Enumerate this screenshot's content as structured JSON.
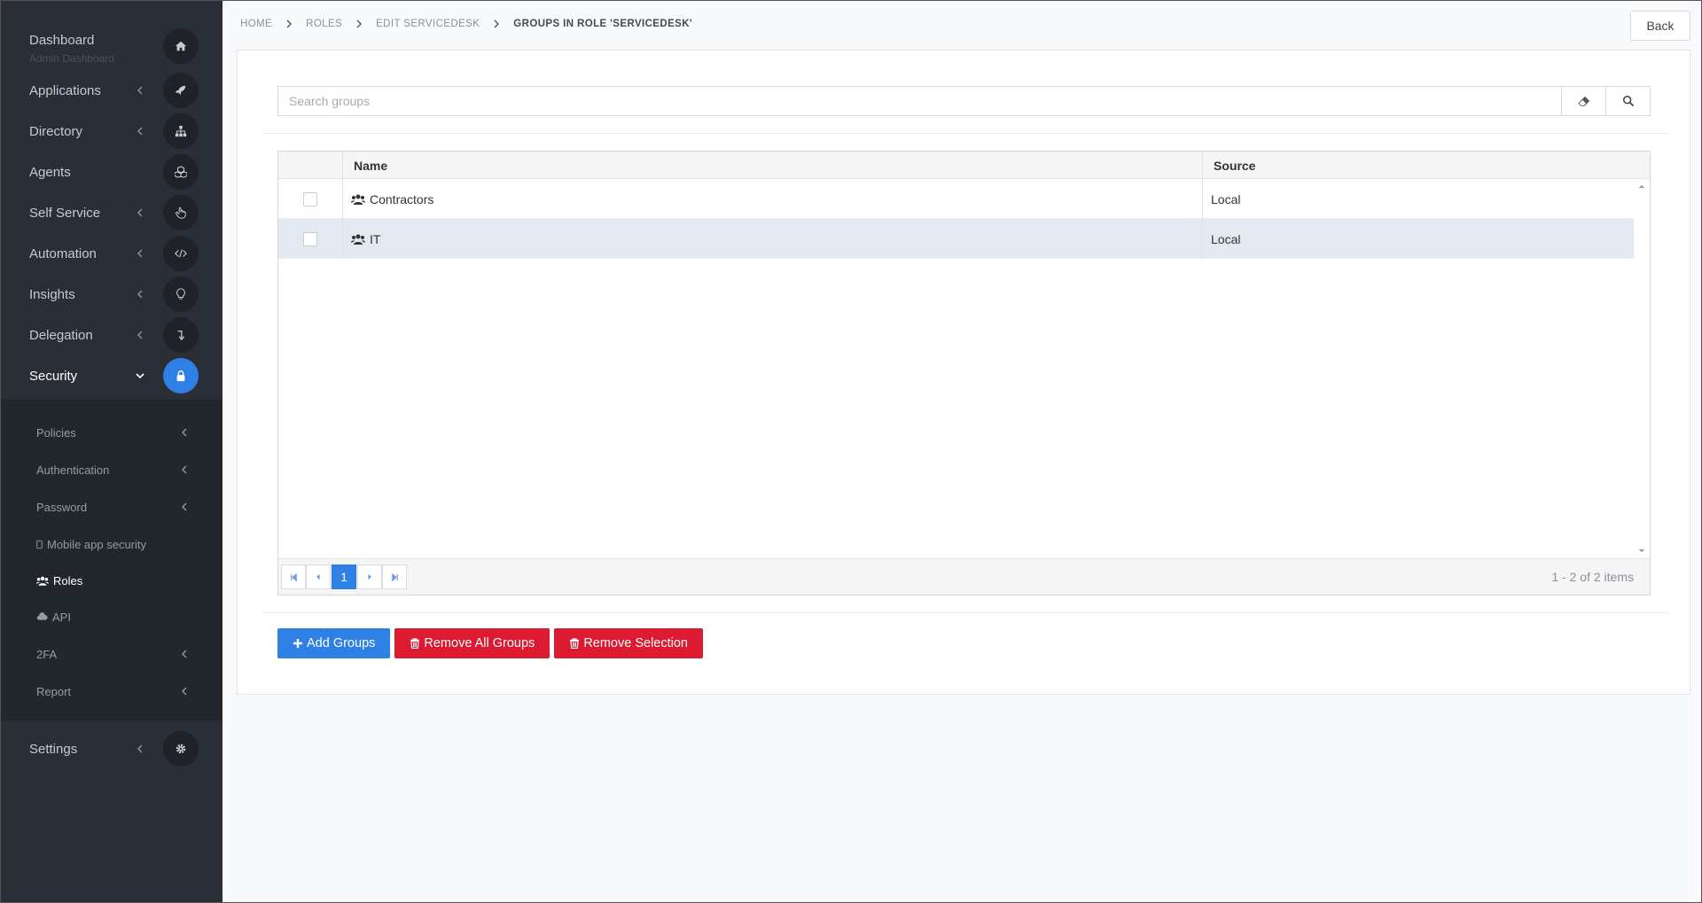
{
  "sidebar": {
    "items": [
      {
        "label": "Dashboard",
        "sub": "Admin Dashboard",
        "icon": "home-icon"
      },
      {
        "label": "Applications",
        "icon": "rocket-icon"
      },
      {
        "label": "Directory",
        "icon": "sitemap-icon"
      },
      {
        "label": "Agents",
        "icon": "cubes-icon"
      },
      {
        "label": "Self Service",
        "icon": "pointer-hand-icon"
      },
      {
        "label": "Automation",
        "icon": "code-icon"
      },
      {
        "label": "Insights",
        "icon": "lightbulb-icon"
      },
      {
        "label": "Delegation",
        "icon": "level-down-icon"
      },
      {
        "label": "Security",
        "icon": "lock-icon"
      },
      {
        "label": "Settings",
        "icon": "gear-icon"
      }
    ],
    "security_sub": [
      {
        "label": "Policies"
      },
      {
        "label": "Authentication"
      },
      {
        "label": "Password"
      },
      {
        "label": "Mobile app security",
        "icon": "mobile-icon"
      },
      {
        "label": "Roles",
        "icon": "users-icon"
      },
      {
        "label": "API",
        "icon": "cloud-icon"
      },
      {
        "label": "2FA"
      },
      {
        "label": "Report"
      }
    ]
  },
  "breadcrumb": [
    "HOME",
    "ROLES",
    "EDIT SERVICEDESK",
    "GROUPS IN ROLE 'SERVICEDESK'"
  ],
  "back_label": "Back",
  "search": {
    "placeholder": "Search groups"
  },
  "grid": {
    "columns": [
      "Name",
      "Source"
    ],
    "rows": [
      {
        "name": "Contractors",
        "source": "Local"
      },
      {
        "name": "IT",
        "source": "Local"
      }
    ],
    "pager": {
      "current": "1",
      "info": "1 - 2 of 2 items"
    }
  },
  "buttons": {
    "add": "Add Groups",
    "remove_all": "Remove All Groups",
    "remove_selection": "Remove Selection"
  },
  "colors": {
    "accent": "#2f80e4",
    "danger": "#dc1b33",
    "sidebar": "#2a2e36"
  }
}
